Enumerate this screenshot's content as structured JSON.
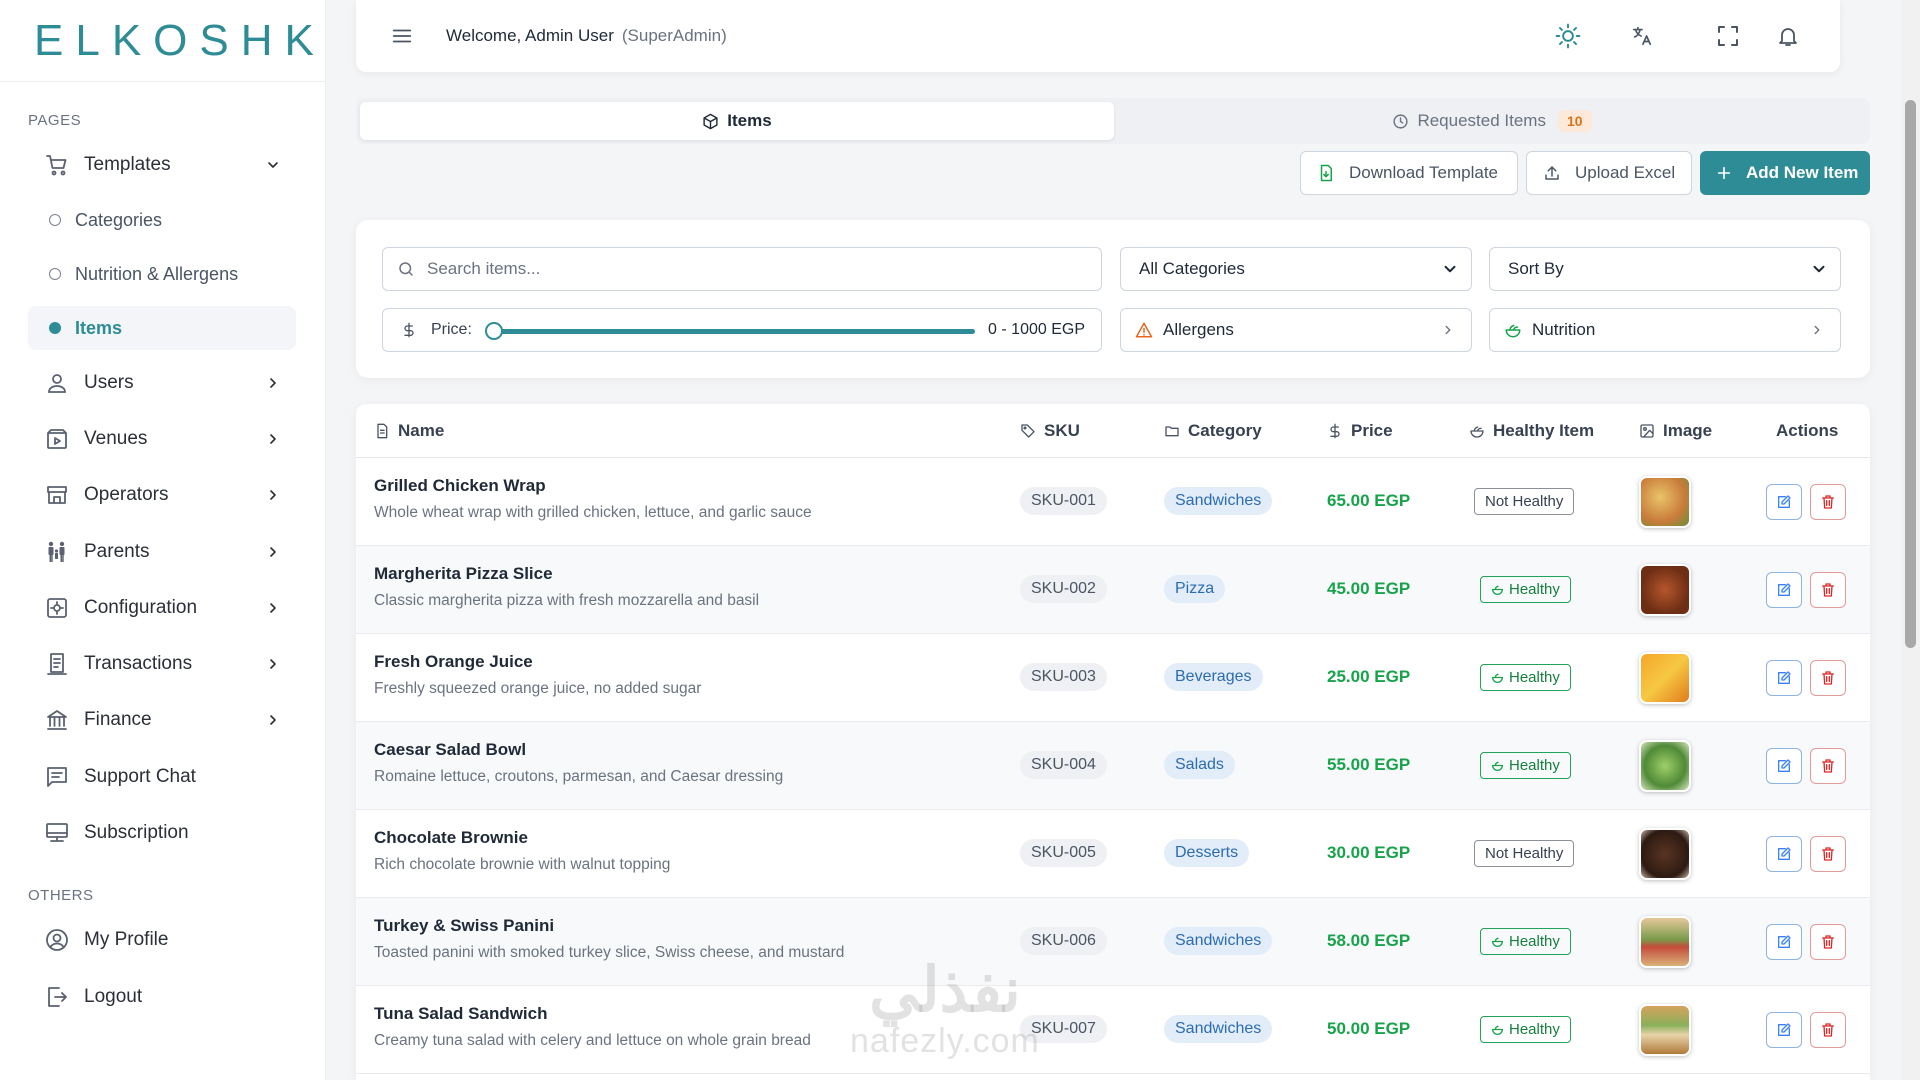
{
  "brand": {
    "logo_text": "ELKOSHK",
    "accent": "#2e8c96"
  },
  "sidebar": {
    "pages_title": "PAGES",
    "others_title": "OTHERS",
    "templates": {
      "label": "Templates",
      "icon": "cart-icon",
      "expanded": true
    },
    "sub_items": [
      {
        "label": "Categories",
        "active": false
      },
      {
        "label": "Nutrition & Allergens",
        "active": false
      },
      {
        "label": "Items",
        "active": true
      }
    ],
    "items": [
      {
        "label": "Users",
        "icon": "user-icon"
      },
      {
        "label": "Venues",
        "icon": "venue-icon"
      },
      {
        "label": "Operators",
        "icon": "store-icon"
      },
      {
        "label": "Parents",
        "icon": "parents-icon"
      },
      {
        "label": "Configuration",
        "icon": "settings-icon"
      },
      {
        "label": "Transactions",
        "icon": "receipt-icon"
      },
      {
        "label": "Finance",
        "icon": "bank-icon"
      },
      {
        "label": "Support Chat",
        "icon": "chat-icon"
      },
      {
        "label": "Subscription",
        "icon": "subscription-icon"
      }
    ],
    "others": [
      {
        "label": "My Profile",
        "icon": "profile-icon"
      },
      {
        "label": "Logout",
        "icon": "logout-icon"
      }
    ]
  },
  "header": {
    "welcome": "Welcome, Admin User",
    "role": "(SuperAdmin)",
    "icons": [
      "sun-icon",
      "translate-icon",
      "fullscreen-icon",
      "bell-icon"
    ]
  },
  "tabs": {
    "items_label": "Items",
    "requested_label": "Requested Items",
    "requested_count": "10"
  },
  "actions": {
    "download": "Download Template",
    "upload": "Upload Excel",
    "add": "Add New Item"
  },
  "filters": {
    "search_placeholder": "Search items...",
    "category": "All Categories",
    "sort": "Sort By",
    "price_label": "Price:",
    "price_range": "0 - 1000 EGP",
    "price_min_fraction": 0,
    "price_max_fraction": 1,
    "allergens": "Allergens",
    "nutrition": "Nutrition"
  },
  "table": {
    "headers": {
      "name": "Name",
      "sku": "SKU",
      "category": "Category",
      "price": "Price",
      "healthy": "Healthy Item",
      "image": "Image",
      "actions": "Actions"
    },
    "rows": [
      {
        "name": "Grilled Chicken Wrap",
        "desc": "Whole wheat wrap with grilled chicken, lettuce, and garlic sauce",
        "sku": "SKU-001",
        "category": "Sandwiches",
        "price": "65.00 EGP",
        "health": "Not Healthy",
        "healthy": false
      },
      {
        "name": "Margherita Pizza Slice",
        "desc": "Classic margherita pizza with fresh mozzarella and basil",
        "sku": "SKU-002",
        "category": "Pizza",
        "price": "45.00 EGP",
        "health": "Healthy",
        "healthy": true
      },
      {
        "name": "Fresh Orange Juice",
        "desc": "Freshly squeezed orange juice, no added sugar",
        "sku": "SKU-003",
        "category": "Beverages",
        "price": "25.00 EGP",
        "health": "Healthy",
        "healthy": true
      },
      {
        "name": "Caesar Salad Bowl",
        "desc": "Romaine lettuce, croutons, parmesan, and Caesar dressing",
        "sku": "SKU-004",
        "category": "Salads",
        "price": "55.00 EGP",
        "health": "Healthy",
        "healthy": true
      },
      {
        "name": "Chocolate Brownie",
        "desc": "Rich chocolate brownie with walnut topping",
        "sku": "SKU-005",
        "category": "Desserts",
        "price": "30.00 EGP",
        "health": "Not Healthy",
        "healthy": false
      },
      {
        "name": "Turkey & Swiss Panini",
        "desc": "Toasted panini with smoked turkey slice, Swiss cheese, and mustard",
        "sku": "SKU-006",
        "category": "Sandwiches",
        "price": "58.00 EGP",
        "health": "Healthy",
        "healthy": true
      },
      {
        "name": "Tuna Salad Sandwich",
        "desc": "Creamy tuna salad with celery and lettuce on whole grain bread",
        "sku": "SKU-007",
        "category": "Sandwiches",
        "price": "50.00 EGP",
        "health": "Healthy",
        "healthy": true
      }
    ]
  },
  "watermark": {
    "line1": "نفذلي",
    "line2": "nafezly.com"
  }
}
